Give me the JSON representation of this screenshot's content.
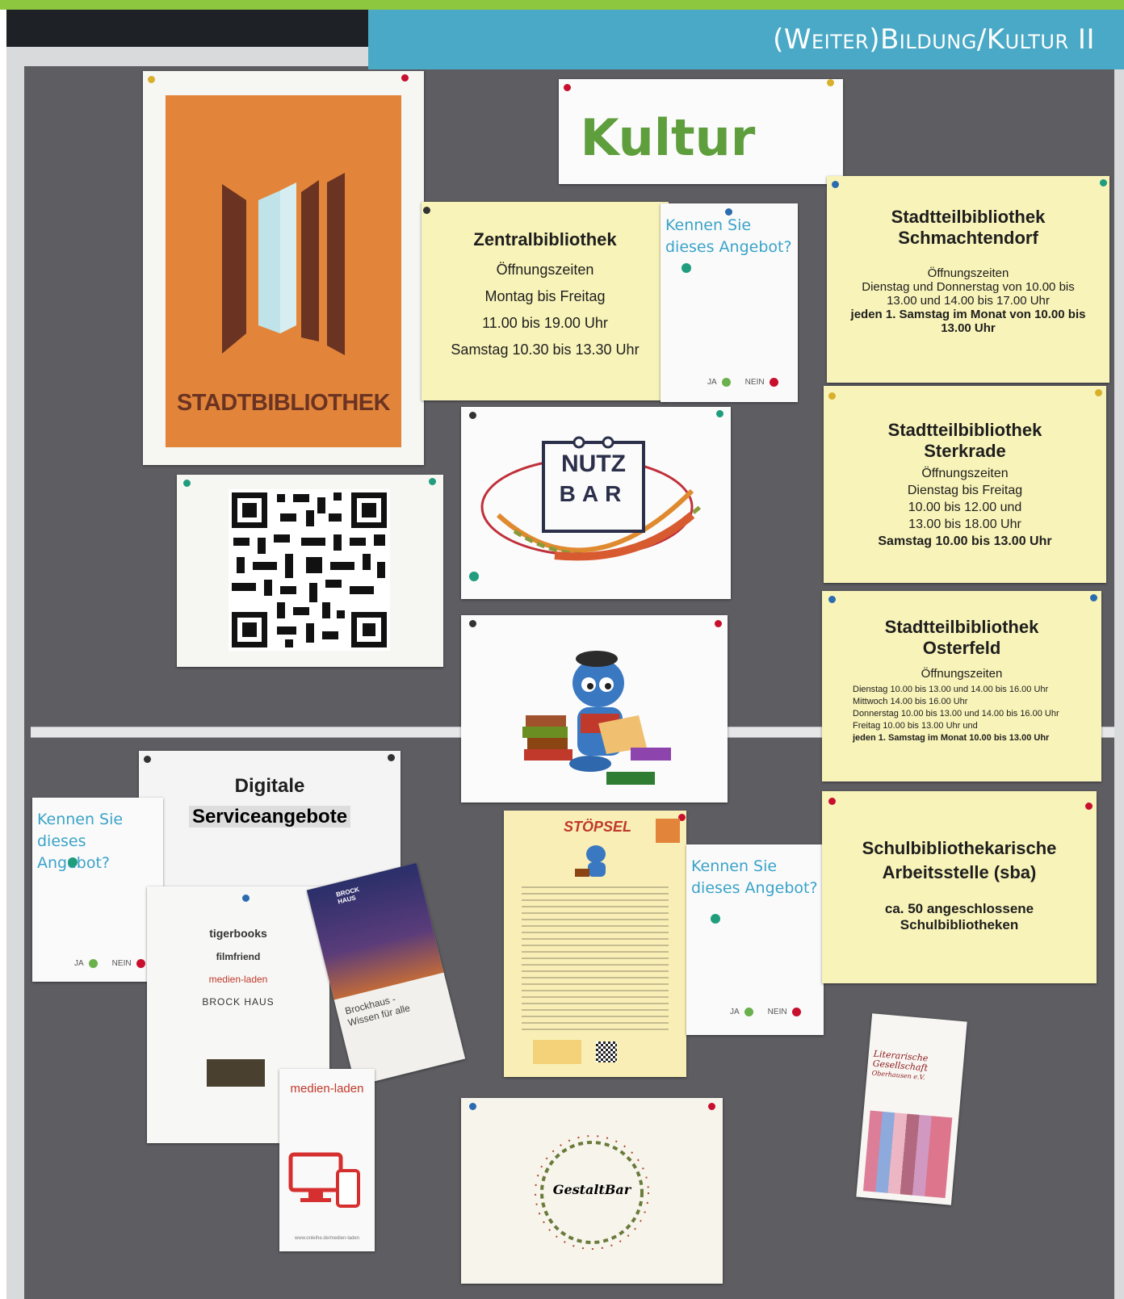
{
  "header": {
    "title": "(Weiter)Bildung/Kultur II"
  },
  "colors": {
    "top_bar": "#8dc63f",
    "header_band": "#4aa9c6",
    "kultur_green": "#5e9e3c",
    "ask_blue": "#3aa3c9",
    "dot_green": "#1f9d7d",
    "dot_red": "#c8102e",
    "poster_orange": "#e2853a"
  },
  "board": {
    "kultur_sign": {
      "title": "Kultur"
    },
    "stadtbibliothek_poster": {
      "label": "STADTBIBLIOTHEK"
    },
    "zentral": {
      "title": "Zentralbibliothek",
      "line1": "Öffnungszeiten",
      "line2": "Montag bis Freitag",
      "line3": "11.00 bis 19.00 Uhr",
      "line4": "Samstag 10.30 bis 13.30 Uhr"
    },
    "survey": {
      "question_line1": "Kennen Sie",
      "question_line2": "dieses Angebot?",
      "yes": "JA",
      "no": "NEIN"
    },
    "schmachtendorf": {
      "title_line1": "Stadtteilbibliothek",
      "title_line2": "Schmachtendorf",
      "hours_label": "Öffnungszeiten",
      "line1": "Dienstag und Donnerstag von 10.00 bis",
      "line2": "13.00 und 14.00 bis 17.00 Uhr",
      "line3": "jeden 1. Samstag im Monat von 10.00 bis",
      "line4": "13.00 Uhr"
    },
    "sterkrade": {
      "title_line1": "Stadtteilbibliothek",
      "title_line2": "Sterkrade",
      "hours_label": "Öffnungszeiten",
      "line1": "Dienstag bis Freitag",
      "line2": "10.00 bis 12.00 und",
      "line3": "13.00 bis 18.00 Uhr",
      "line4": "Samstag 10.00 bis 13.00 Uhr"
    },
    "osterfeld": {
      "title_line1": "Stadtteilbibliothek",
      "title_line2": "Osterfeld",
      "hours_label": "Öffnungszeiten",
      "line1": "Dienstag 10.00 bis 13.00 und 14.00 bis 16.00 Uhr",
      "line2": "Mittwoch 14.00 bis 16.00 Uhr",
      "line3": "Donnerstag 10.00 bis 13.00 und 14.00 bis 16.00 Uhr",
      "line4": "Freitag 10.00 bis 13.00 Uhr und",
      "line5": "jeden 1. Samstag im Monat 10.00 bis 13.00 Uhr"
    },
    "nutzbar": {
      "line1": "NUTZ",
      "line2": "BAR"
    },
    "digitale": {
      "title_line1": "Digitale",
      "title_line2": "Serviceangebote"
    },
    "digital_logos": [
      "tigerbooks",
      "filmfriend",
      "medien-laden",
      "BROCK HAUS"
    ],
    "brockhaus_flyer": {
      "brand": "BROCK HAUS",
      "tagline_line1": "Brockhaus -",
      "tagline_line2": "Wissen für alle"
    },
    "medienladen_flyer": {
      "brand": "medien-laden",
      "url": "www.onleihe.de/medien-laden"
    },
    "stoepsel": {
      "title": "STÖPSEL"
    },
    "sba": {
      "title_line1": "Schulbibliothekarische",
      "title_line2": "Arbeitsstelle (sba)",
      "line1": "ca. 50 angeschlossene",
      "line2": "Schulbibliotheken"
    },
    "gestaltbar": {
      "label": "GestaltBar"
    },
    "literarische": {
      "line1": "Literarische",
      "line2": "Gesellschaft",
      "line3": "Oberhausen e.V."
    }
  }
}
